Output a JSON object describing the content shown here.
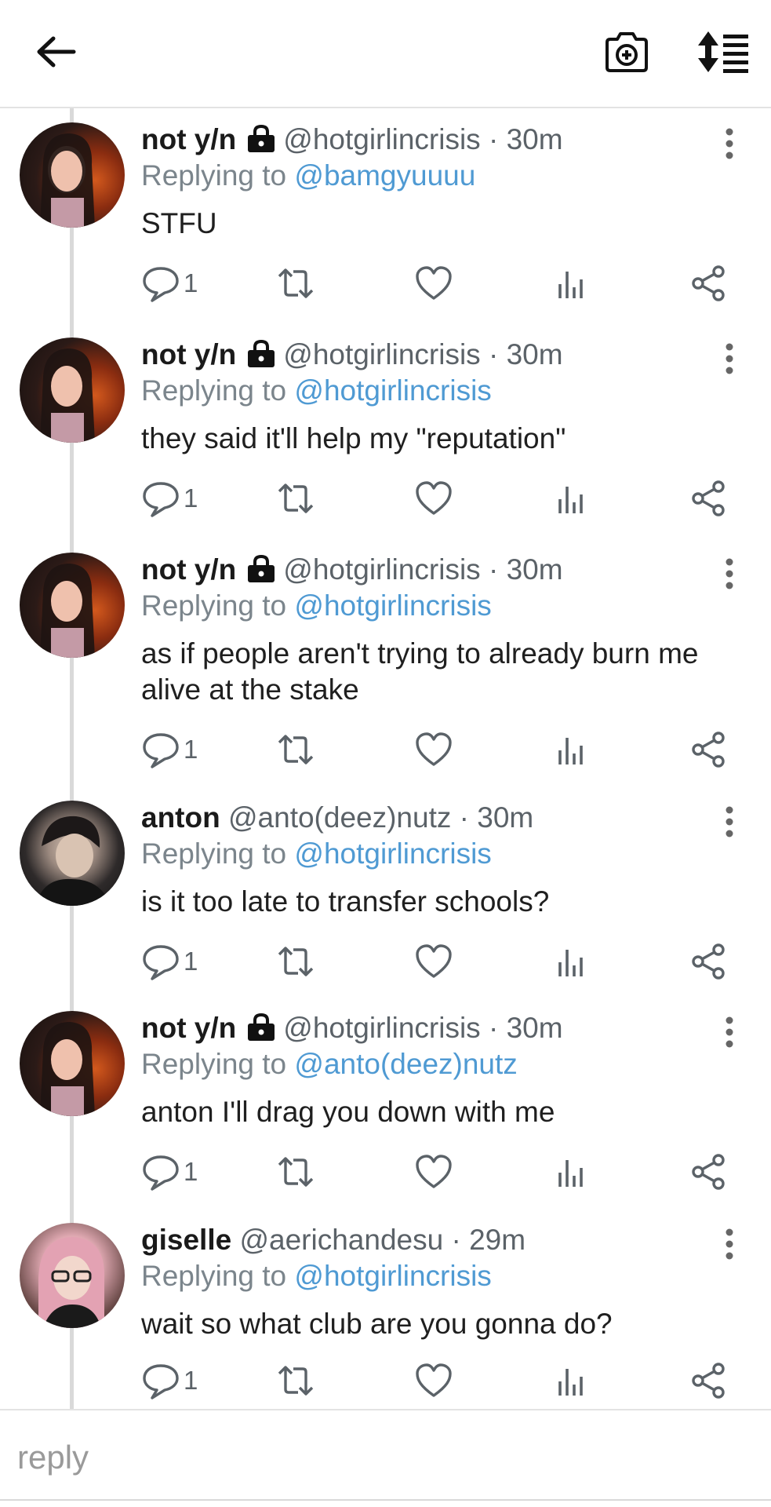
{
  "reply_placeholder": "reply",
  "colors": {
    "mention": "#4f9ad3",
    "meta": "#7b858c",
    "divider": "#e3e3e3"
  },
  "icons": {
    "header": [
      "back-arrow-icon",
      "camera-add-icon",
      "sort-order-icon"
    ],
    "actions": [
      "reply-icon",
      "retweet-icon",
      "like-icon",
      "stats-icon",
      "share-icon"
    ]
  },
  "tweets": [
    {
      "name": "not y/n",
      "handle": "@hotgirlincrisis",
      "sep": "·",
      "time": "30m",
      "locked": true,
      "reply_prefix": "Replying to",
      "reply_to": "@bamgyuuuu",
      "text": "STFU",
      "reply_count": "1"
    },
    {
      "name": "not y/n",
      "handle": "@hotgirlincrisis",
      "sep": "·",
      "time": "30m",
      "locked": true,
      "reply_prefix": "Replying to",
      "reply_to": "@hotgirlincrisis",
      "text": "they said it'll help my \"reputation\"",
      "reply_count": "1"
    },
    {
      "name": "not y/n",
      "handle": "@hotgirlincrisis",
      "sep": "·",
      "time": "30m",
      "locked": true,
      "reply_prefix": "Replying to",
      "reply_to": "@hotgirlincrisis",
      "text": "as if people aren't trying to already burn me alive at the stake",
      "reply_count": "1"
    },
    {
      "name": "anton",
      "handle": "@anto(deez)nutz",
      "sep": "·",
      "time": "30m",
      "locked": false,
      "reply_prefix": "Replying to",
      "reply_to": "@hotgirlincrisis",
      "text": "is it too late to transfer schools?",
      "reply_count": "1"
    },
    {
      "name": "not y/n",
      "handle": "@hotgirlincrisis",
      "sep": "·",
      "time": "30m",
      "locked": true,
      "reply_prefix": "Replying to",
      "reply_to": "@anto(deez)nutz",
      "text": "anton I'll drag you down with me",
      "reply_count": "1"
    },
    {
      "name": "giselle",
      "handle": "@aerichandesu",
      "sep": "·",
      "time": "29m",
      "locked": false,
      "reply_prefix": "Replying to",
      "reply_to": "@hotgirlincrisis",
      "text": "wait so what club are you gonna do?",
      "reply_count": "1"
    }
  ]
}
